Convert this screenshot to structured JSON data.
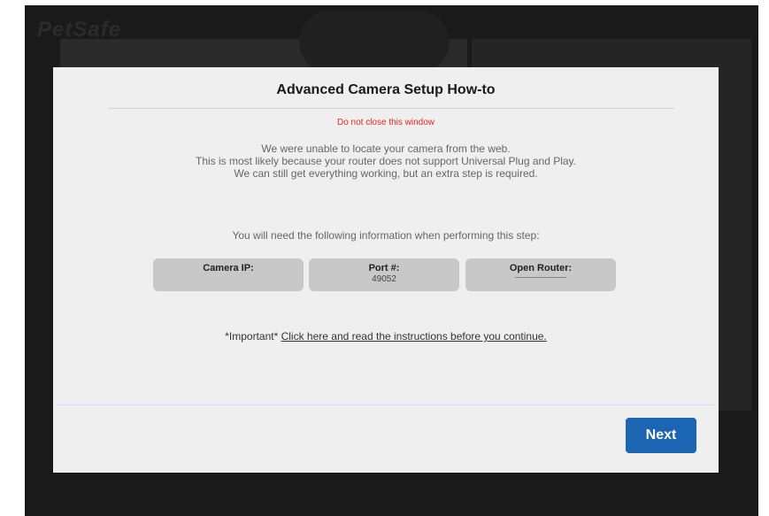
{
  "background": {
    "logo_text": "PetSafe"
  },
  "dialog": {
    "title": "Advanced Camera Setup How-to",
    "warning": "Do not close this window",
    "description_lines": [
      "We were unable to locate your camera from the web.",
      "This is most likely because your router does not support Universal Plug and Play.",
      "We can still get everything working, but an extra step is required."
    ],
    "need_info": "You will need the following information when performing this step:",
    "info_boxes": [
      {
        "label": "Camera IP:",
        "value": ""
      },
      {
        "label": "Port #:",
        "value": "49052"
      },
      {
        "label": "Open Router:",
        "value": ""
      }
    ],
    "important_prefix": "*Important*",
    "important_link": "Click here and read the instructions before you continue.",
    "next_label": "Next"
  },
  "colors": {
    "warning": "#e8241c",
    "next_button": "#1b65b2",
    "info_box": "#c8c8c8"
  }
}
